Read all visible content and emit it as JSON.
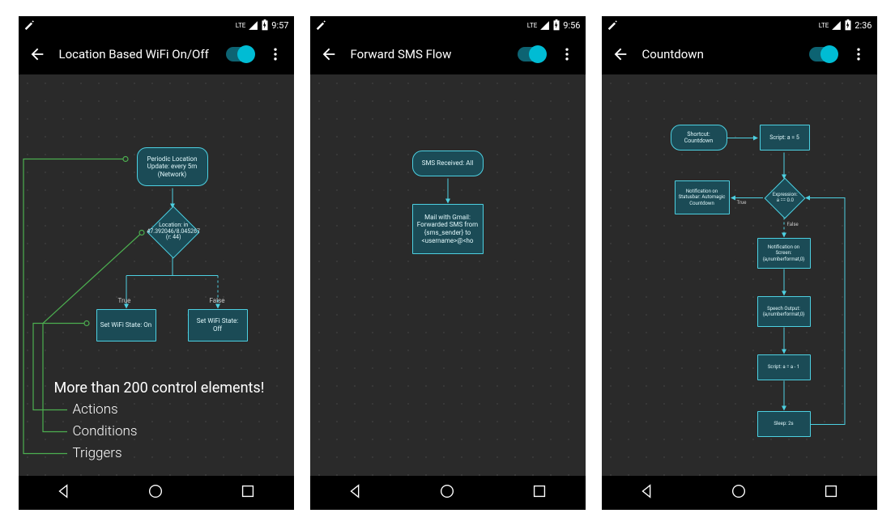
{
  "screens": [
    {
      "status": {
        "lte": "LTE",
        "battery": "🗲",
        "time": "9:57",
        "magic": "✦"
      },
      "title": "Location Based WiFi On/Off",
      "toggle": true,
      "nodes": {
        "trigger": "Periodic Location Update: every 5m (Network)",
        "condition": "Location: in 47.392046/8.045267 (r: 44)",
        "trueLabel": "True",
        "falseLabel": "False",
        "actionTrue": "Set WiFi State: On",
        "actionFalse": "Set WiFi State: Off"
      },
      "overlay": {
        "headline": "More than 200 control elements!",
        "b1": "Actions",
        "b2": "Conditions",
        "b3": "Triggers"
      }
    },
    {
      "status": {
        "lte": "LTE",
        "battery": "🗲",
        "time": "9:56",
        "magic": "✦"
      },
      "title": "Forward SMS Flow",
      "toggle": true,
      "nodes": {
        "trigger": "SMS Received: All",
        "action": "Mail with Gmail: Forwarded SMS from {sms_sender} to <username>@<ho"
      }
    },
    {
      "status": {
        "lte": "LTE",
        "battery": "🗲",
        "time": "2:36",
        "magic": "✦"
      },
      "title": "Countdown",
      "toggle": true,
      "nodes": {
        "n1": "Shortcut: Countdown",
        "n2": "Script: a = 5",
        "cond": "Expression: a == 0.0",
        "condTrueLabel": "True",
        "condFalseLabel": "False",
        "nTrue": "Notification on Statusbar: Automagic Countdown",
        "nF1": "Notification on Screen: {a,numberformat,0}",
        "nF2": "Speech Output: {a,numberformat,0}",
        "nF3": "Script: a = a - 1",
        "nF4": "Sleep: 2s"
      }
    }
  ]
}
